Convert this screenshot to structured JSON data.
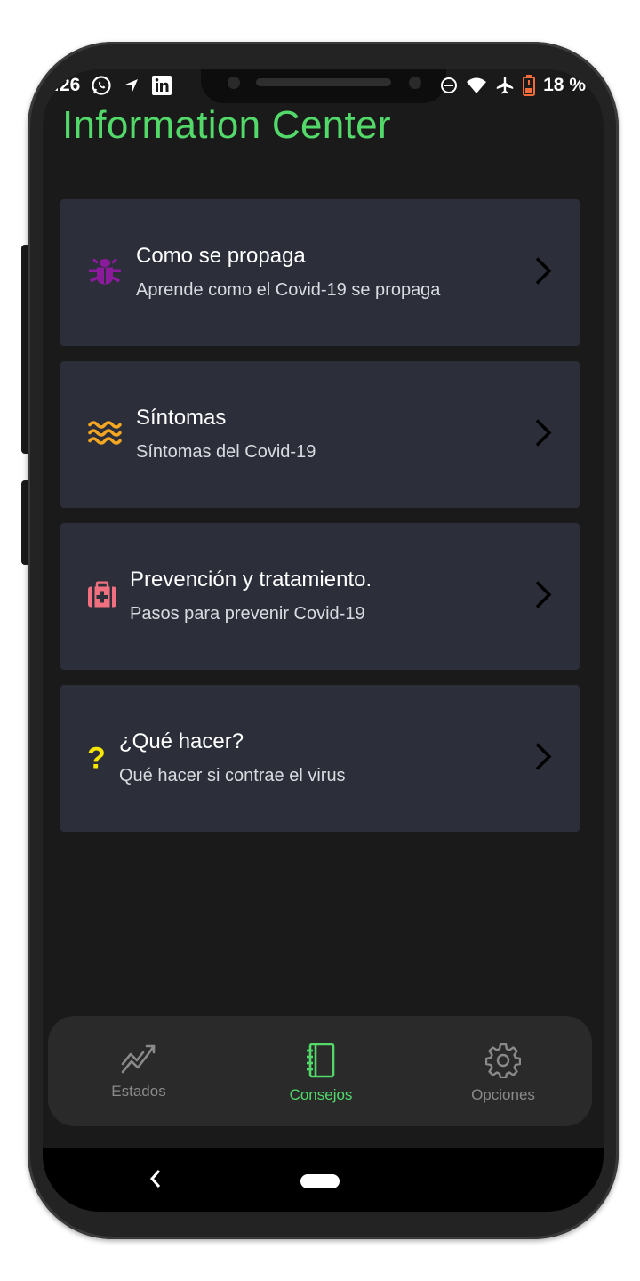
{
  "status_bar": {
    "time": ":26",
    "battery": "18 %"
  },
  "title": "Information Center",
  "cards": [
    {
      "title": "Como se propaga",
      "subtitle": "Aprende como el Covid-19 se propaga",
      "icon": "bug-icon",
      "icon_color": "#8b1a9c"
    },
    {
      "title": "Síntomas",
      "subtitle": "Síntomas del Covid-19",
      "icon": "waves-icon",
      "icon_color": "#f5a623"
    },
    {
      "title": "Prevención y tratamiento.",
      "subtitle": "Pasos para prevenir Covid-19",
      "icon": "medical-kit-icon",
      "icon_color": "#f07080"
    },
    {
      "title": "¿Qué hacer?",
      "subtitle": "Qué hacer si contrae el virus",
      "icon": "question-icon",
      "icon_color": "#f7e600",
      "icon_glyph": "?"
    }
  ],
  "bottom_nav": {
    "items": [
      {
        "label": "Estados",
        "icon": "chart-line-icon",
        "active": false
      },
      {
        "label": "Consejos",
        "icon": "notebook-icon",
        "active": true
      },
      {
        "label": "Opciones",
        "icon": "gear-icon",
        "active": false
      }
    ]
  },
  "colors": {
    "accent": "#52d96a",
    "card_bg": "#2c2f3a",
    "background": "#1a1a1a",
    "inactive": "#8a8a8a"
  },
  "system_nav": {
    "back_glyph": "‹"
  }
}
